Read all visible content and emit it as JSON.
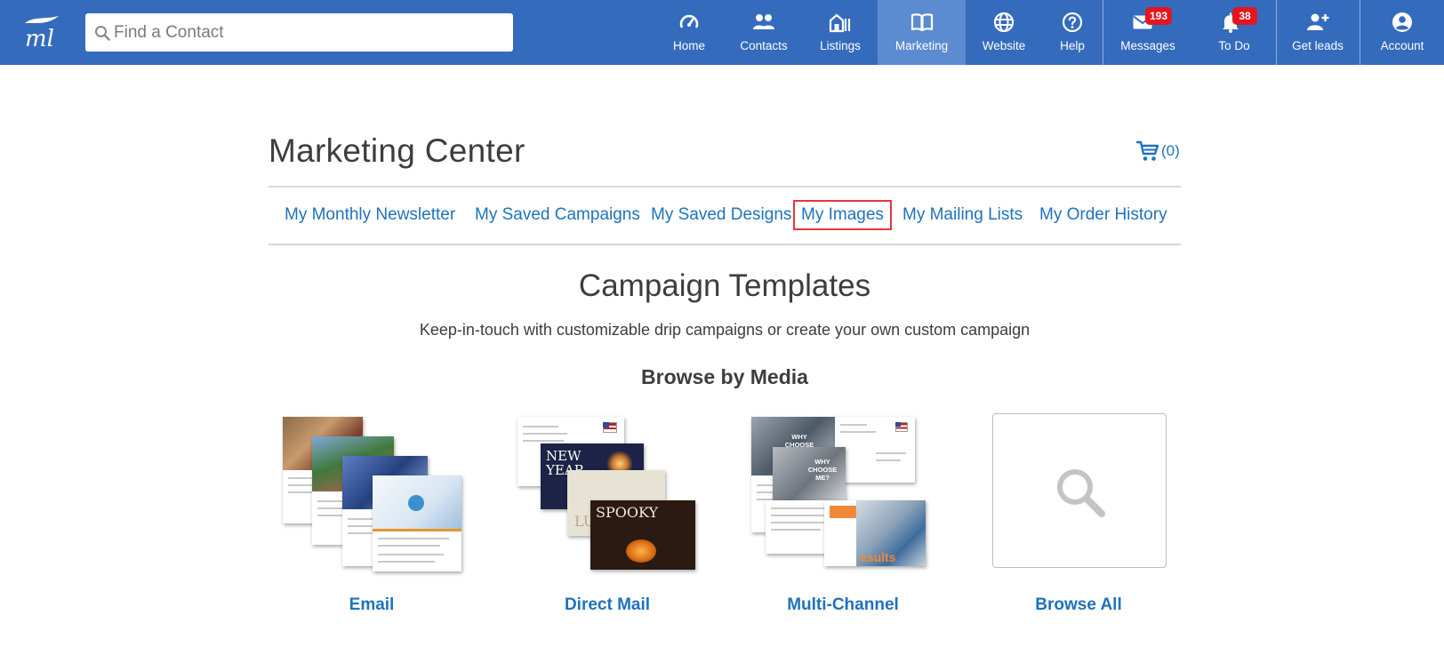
{
  "header": {
    "search": {
      "placeholder": "Find a Contact",
      "value": ""
    },
    "nav": [
      {
        "label": "Home",
        "icon": "dashboard-gauge-icon"
      },
      {
        "label": "Contacts",
        "icon": "people-icon"
      },
      {
        "label": "Listings",
        "icon": "buildings-icon"
      },
      {
        "label": "Marketing",
        "icon": "open-book-icon",
        "active": true
      },
      {
        "label": "Website",
        "icon": "globe-icon"
      },
      {
        "label": "Help",
        "icon": "question-circle-icon"
      },
      {
        "label": "Messages",
        "icon": "envelope-icon",
        "badge": "193"
      },
      {
        "label": "To Do",
        "icon": "bell-icon",
        "badge": "38"
      },
      {
        "label": "Get leads",
        "icon": "add-user-icon"
      },
      {
        "label": "Account",
        "icon": "user-circle-icon"
      }
    ]
  },
  "main": {
    "title": "Marketing Center",
    "cart_count": "(0)",
    "subnav": [
      {
        "label": "My Monthly Newsletter"
      },
      {
        "label": "My Saved Campaigns"
      },
      {
        "label": "My Saved Designs"
      },
      {
        "label": "My Images",
        "highlighted": true
      },
      {
        "label": "My Mailing Lists"
      },
      {
        "label": "My Order History"
      }
    ],
    "section_title": "Campaign Templates",
    "section_desc": "Keep-in-touch with customizable drip campaigns or create your own custom campaign",
    "browse_title": "Browse by Media",
    "media": [
      {
        "label": "Email"
      },
      {
        "label": "Direct Mail",
        "card_text_1": "NEW YEAR",
        "card_text_2": "SPOOKY",
        "card_text_3": "LU"
      },
      {
        "label": "Multi-Channel",
        "card_text_1": "WHY CHOOSE ME?",
        "card_text_2": "WHY CHOOSE ME?",
        "card_text_3": "esults"
      },
      {
        "label": "Browse All"
      }
    ]
  },
  "colors": {
    "topbar": "#346bbd",
    "active_tab": "#5b8bd0",
    "link": "#1e72bd",
    "badge": "#e3151e",
    "highlight_outline": "#e8353c"
  }
}
